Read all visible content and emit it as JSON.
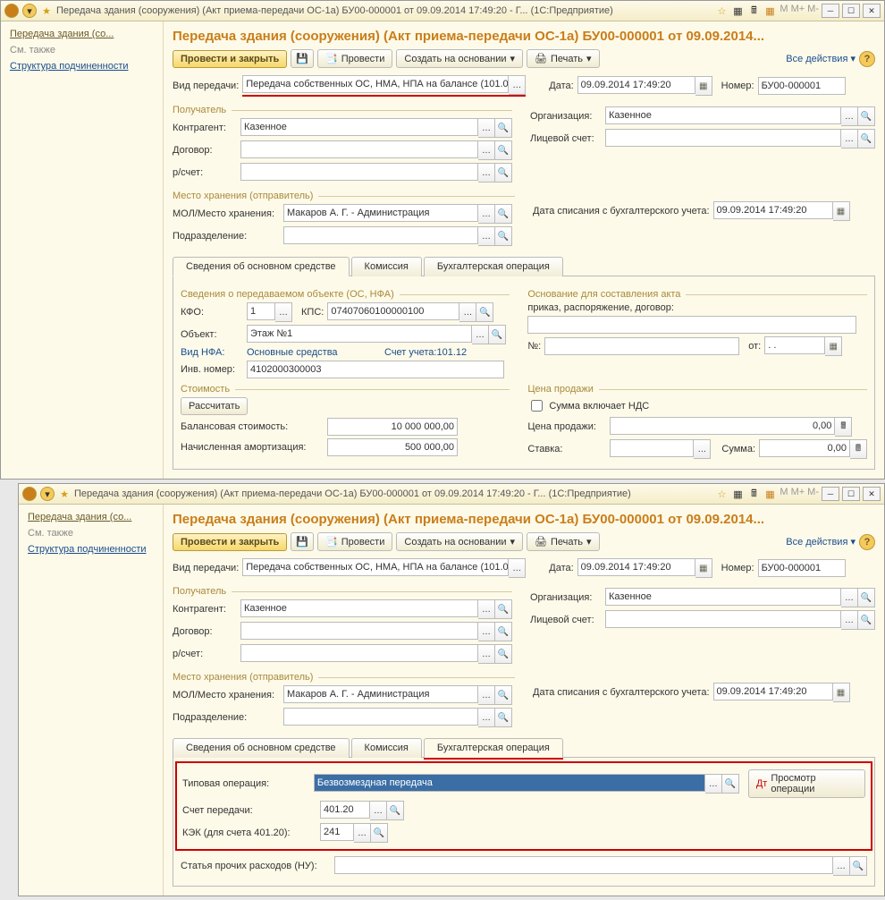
{
  "titlebar": {
    "app": "(1С:Предприятие)",
    "title_window": "Передача здания (сооружения) (Акт приема-передачи ОС-1а) БУ00-000001 от 09.09.2014 17:49:20 - Г...",
    "m_labels": [
      "M",
      "M+",
      "M-"
    ]
  },
  "sidebar": {
    "active": "Передача здания (со...",
    "see_also": "См. также",
    "items": [
      "Структура подчиненности"
    ]
  },
  "doc": {
    "title_part1": "Передача здания (сооружения) (Акт приема-передачи ОС-1а)",
    "title_part2": " БУ00-000001 от 09.09.2014..."
  },
  "toolbar": {
    "post_close": "Провести и закрыть",
    "post": "Провести",
    "create_on": "Создать на основании",
    "print": "Печать",
    "all_actions": "Все действия"
  },
  "fields": {
    "vid_label": "Вид передачи:",
    "vid_value": "Передача собственных ОС, НМА, НПА на балансе (101.0(",
    "date_label": "Дата:",
    "date_value": "09.09.2014 17:49:20",
    "number_label": "Номер:",
    "number_value": "БУ00-000001",
    "recipient_hdr": "Получатель",
    "org_label": "Организация:",
    "org_value": "Казенное",
    "contr_label": "Контрагент:",
    "contr_value": "Казенное",
    "acct_label": "Лицевой счет:",
    "dogovor_label": "Договор:",
    "rs_label": "р/счет:",
    "storage_hdr": "Место хранения (отправитель)",
    "write_off_label": "Дата списания с бухгалтерского учета:",
    "write_off_value": "09.09.2014 17:49:20",
    "mol_label": "МОЛ/Место хранения:",
    "mol_value": "Макаров А. Г. - Администрация",
    "subdiv_label": "Подразделение:"
  },
  "tabs": {
    "t1": "Сведения об основном средстве",
    "t2": "Комиссия",
    "t3": "Бухгалтерская операция"
  },
  "t1body": {
    "transfer_hdr": "Сведения о передаваемом объекте (ОС, НФА)",
    "basis_hdr": "Основание для составления акта",
    "kfo_label": "КФО:",
    "kfo_value": "1",
    "kps_label": "КПС:",
    "kps_value": "07407060100000100",
    "basis_text": "приказ, распоряжение, договор:",
    "object_label": "Объект:",
    "object_value": "Этаж №1",
    "nfa_label": "Вид НФА:",
    "nfa_value": "Основные средства",
    "sch_label": "Счет учета:101.12",
    "no_label": "№:",
    "from_label": "от:",
    "from_value": ". .",
    "inv_label": "Инв. номер:",
    "inv_value": "4102000300003",
    "cost_hdr": "Стоимость",
    "price_hdr": "Цена продажи",
    "calc_btn": "Рассчитать",
    "vat_check": "Сумма включает НДС",
    "balance_label": "Балансовая стоимость:",
    "balance_value": "10 000 000,00",
    "price_label": "Цена продажи:",
    "price_value": "0,00",
    "amort_label": "Начисленная амортизация:",
    "amort_value": "500 000,00",
    "rate_label": "Ставка:",
    "sum_label": "Сумма:",
    "sum_value": "0,00"
  },
  "t3body": {
    "op_label": "Типовая операция:",
    "op_value": "Безвозмездная передача",
    "view_op": "Просмотр операции",
    "sch_per_label": "Счет передачи:",
    "sch_per_value": "401.20",
    "kek_label": "КЭК (для счета 401.20):",
    "kek_value": "241",
    "other_label": "Статья прочих расходов (НУ):"
  }
}
